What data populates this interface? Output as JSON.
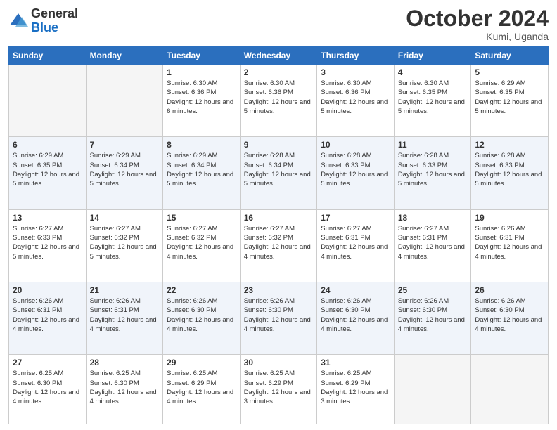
{
  "logo": {
    "general": "General",
    "blue": "Blue"
  },
  "header": {
    "month": "October 2024",
    "location": "Kumi, Uganda"
  },
  "weekdays": [
    "Sunday",
    "Monday",
    "Tuesday",
    "Wednesday",
    "Thursday",
    "Friday",
    "Saturday"
  ],
  "weeks": [
    [
      {
        "day": "",
        "sunrise": "",
        "sunset": "",
        "daylight": ""
      },
      {
        "day": "",
        "sunrise": "",
        "sunset": "",
        "daylight": ""
      },
      {
        "day": "1",
        "sunrise": "Sunrise: 6:30 AM",
        "sunset": "Sunset: 6:36 PM",
        "daylight": "Daylight: 12 hours and 6 minutes."
      },
      {
        "day": "2",
        "sunrise": "Sunrise: 6:30 AM",
        "sunset": "Sunset: 6:36 PM",
        "daylight": "Daylight: 12 hours and 5 minutes."
      },
      {
        "day": "3",
        "sunrise": "Sunrise: 6:30 AM",
        "sunset": "Sunset: 6:36 PM",
        "daylight": "Daylight: 12 hours and 5 minutes."
      },
      {
        "day": "4",
        "sunrise": "Sunrise: 6:30 AM",
        "sunset": "Sunset: 6:35 PM",
        "daylight": "Daylight: 12 hours and 5 minutes."
      },
      {
        "day": "5",
        "sunrise": "Sunrise: 6:29 AM",
        "sunset": "Sunset: 6:35 PM",
        "daylight": "Daylight: 12 hours and 5 minutes."
      }
    ],
    [
      {
        "day": "6",
        "sunrise": "Sunrise: 6:29 AM",
        "sunset": "Sunset: 6:35 PM",
        "daylight": "Daylight: 12 hours and 5 minutes."
      },
      {
        "day": "7",
        "sunrise": "Sunrise: 6:29 AM",
        "sunset": "Sunset: 6:34 PM",
        "daylight": "Daylight: 12 hours and 5 minutes."
      },
      {
        "day": "8",
        "sunrise": "Sunrise: 6:29 AM",
        "sunset": "Sunset: 6:34 PM",
        "daylight": "Daylight: 12 hours and 5 minutes."
      },
      {
        "day": "9",
        "sunrise": "Sunrise: 6:28 AM",
        "sunset": "Sunset: 6:34 PM",
        "daylight": "Daylight: 12 hours and 5 minutes."
      },
      {
        "day": "10",
        "sunrise": "Sunrise: 6:28 AM",
        "sunset": "Sunset: 6:33 PM",
        "daylight": "Daylight: 12 hours and 5 minutes."
      },
      {
        "day": "11",
        "sunrise": "Sunrise: 6:28 AM",
        "sunset": "Sunset: 6:33 PM",
        "daylight": "Daylight: 12 hours and 5 minutes."
      },
      {
        "day": "12",
        "sunrise": "Sunrise: 6:28 AM",
        "sunset": "Sunset: 6:33 PM",
        "daylight": "Daylight: 12 hours and 5 minutes."
      }
    ],
    [
      {
        "day": "13",
        "sunrise": "Sunrise: 6:27 AM",
        "sunset": "Sunset: 6:33 PM",
        "daylight": "Daylight: 12 hours and 5 minutes."
      },
      {
        "day": "14",
        "sunrise": "Sunrise: 6:27 AM",
        "sunset": "Sunset: 6:32 PM",
        "daylight": "Daylight: 12 hours and 5 minutes."
      },
      {
        "day": "15",
        "sunrise": "Sunrise: 6:27 AM",
        "sunset": "Sunset: 6:32 PM",
        "daylight": "Daylight: 12 hours and 4 minutes."
      },
      {
        "day": "16",
        "sunrise": "Sunrise: 6:27 AM",
        "sunset": "Sunset: 6:32 PM",
        "daylight": "Daylight: 12 hours and 4 minutes."
      },
      {
        "day": "17",
        "sunrise": "Sunrise: 6:27 AM",
        "sunset": "Sunset: 6:31 PM",
        "daylight": "Daylight: 12 hours and 4 minutes."
      },
      {
        "day": "18",
        "sunrise": "Sunrise: 6:27 AM",
        "sunset": "Sunset: 6:31 PM",
        "daylight": "Daylight: 12 hours and 4 minutes."
      },
      {
        "day": "19",
        "sunrise": "Sunrise: 6:26 AM",
        "sunset": "Sunset: 6:31 PM",
        "daylight": "Daylight: 12 hours and 4 minutes."
      }
    ],
    [
      {
        "day": "20",
        "sunrise": "Sunrise: 6:26 AM",
        "sunset": "Sunset: 6:31 PM",
        "daylight": "Daylight: 12 hours and 4 minutes."
      },
      {
        "day": "21",
        "sunrise": "Sunrise: 6:26 AM",
        "sunset": "Sunset: 6:31 PM",
        "daylight": "Daylight: 12 hours and 4 minutes."
      },
      {
        "day": "22",
        "sunrise": "Sunrise: 6:26 AM",
        "sunset": "Sunset: 6:30 PM",
        "daylight": "Daylight: 12 hours and 4 minutes."
      },
      {
        "day": "23",
        "sunrise": "Sunrise: 6:26 AM",
        "sunset": "Sunset: 6:30 PM",
        "daylight": "Daylight: 12 hours and 4 minutes."
      },
      {
        "day": "24",
        "sunrise": "Sunrise: 6:26 AM",
        "sunset": "Sunset: 6:30 PM",
        "daylight": "Daylight: 12 hours and 4 minutes."
      },
      {
        "day": "25",
        "sunrise": "Sunrise: 6:26 AM",
        "sunset": "Sunset: 6:30 PM",
        "daylight": "Daylight: 12 hours and 4 minutes."
      },
      {
        "day": "26",
        "sunrise": "Sunrise: 6:26 AM",
        "sunset": "Sunset: 6:30 PM",
        "daylight": "Daylight: 12 hours and 4 minutes."
      }
    ],
    [
      {
        "day": "27",
        "sunrise": "Sunrise: 6:25 AM",
        "sunset": "Sunset: 6:30 PM",
        "daylight": "Daylight: 12 hours and 4 minutes."
      },
      {
        "day": "28",
        "sunrise": "Sunrise: 6:25 AM",
        "sunset": "Sunset: 6:30 PM",
        "daylight": "Daylight: 12 hours and 4 minutes."
      },
      {
        "day": "29",
        "sunrise": "Sunrise: 6:25 AM",
        "sunset": "Sunset: 6:29 PM",
        "daylight": "Daylight: 12 hours and 4 minutes."
      },
      {
        "day": "30",
        "sunrise": "Sunrise: 6:25 AM",
        "sunset": "Sunset: 6:29 PM",
        "daylight": "Daylight: 12 hours and 3 minutes."
      },
      {
        "day": "31",
        "sunrise": "Sunrise: 6:25 AM",
        "sunset": "Sunset: 6:29 PM",
        "daylight": "Daylight: 12 hours and 3 minutes."
      },
      {
        "day": "",
        "sunrise": "",
        "sunset": "",
        "daylight": ""
      },
      {
        "day": "",
        "sunrise": "",
        "sunset": "",
        "daylight": ""
      }
    ]
  ]
}
